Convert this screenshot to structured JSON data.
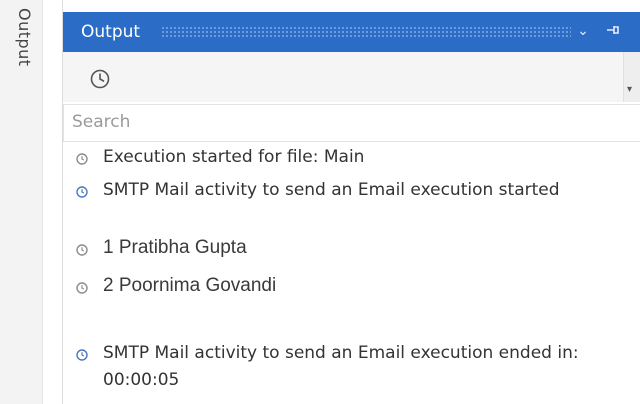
{
  "sidetab": {
    "label": "Output"
  },
  "panel": {
    "title": "Output",
    "title_controls": {
      "collapse_icon": "chevron-down-icon",
      "pin_icon": "pin-icon"
    }
  },
  "toolbar": {
    "history_icon": "clock-icon"
  },
  "search": {
    "placeholder": "Search",
    "value": ""
  },
  "log": {
    "entries": [
      {
        "text": "Execution started for file: Main",
        "kind": "trace"
      },
      {
        "text": "SMTP Mail activity to send an Email execution started",
        "kind": "info"
      },
      {
        "text": "1  Pratibha Gupta",
        "kind": "trace"
      },
      {
        "text": "2  Poornima Govandi",
        "kind": "trace"
      },
      {
        "text": "SMTP Mail activity to send an Email execution ended in: 00:00:05",
        "kind": "info"
      }
    ]
  },
  "colors": {
    "titlebar": "#2b6cc7",
    "info_icon": "#4a78c2",
    "trace_icon": "#8c8c8c"
  }
}
